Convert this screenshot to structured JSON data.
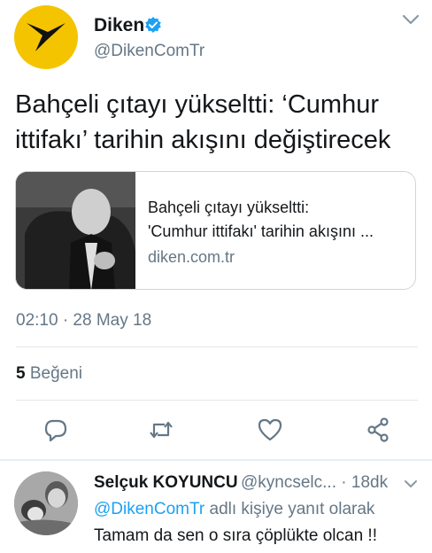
{
  "tweet": {
    "author_name": "Diken",
    "author_handle": "@DikenComTr",
    "text_line1": "Bahçeli çıtayı yükseltti: ‘Cumhur",
    "text_line2": "ittifakı’ tarihin akışını değiştirecek",
    "card": {
      "title_line1": "Bahçeli çıtayı yükseltti:",
      "title_line2": "'Cumhur ittifakı' tarihin akışını ...",
      "domain": "diken.com.tr"
    },
    "timestamp": "02:10 · 28 May 18",
    "likes_count": "5",
    "likes_label": "Beğeni"
  },
  "reply": {
    "author_name": "Selçuk KOYUNCU",
    "author_handle": "@kyncselc...",
    "age": "· 18dk",
    "replying_mention": "@DikenComTr",
    "replying_suffix": "adlı kişiye yanıt olarak",
    "text": "Tamam da sen o sıra çöplükte olcan !!"
  },
  "colors": {
    "brand_yellow": "#f5c400",
    "verified_blue": "#1da1f2",
    "secondary_text": "#657786",
    "link_blue": "#1da1f2"
  },
  "icons": [
    "verified-icon",
    "chevron-down-icon",
    "reply-icon",
    "retweet-icon",
    "like-icon",
    "share-icon"
  ]
}
